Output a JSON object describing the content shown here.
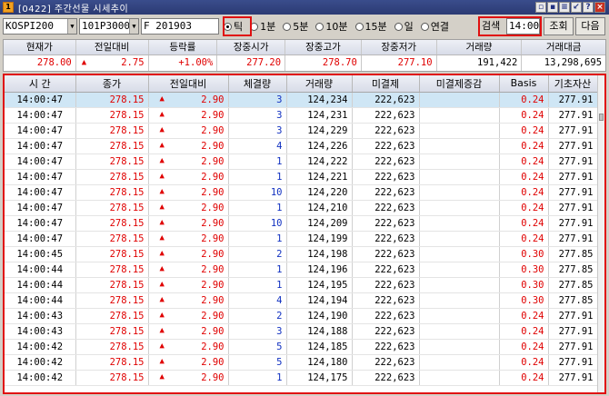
{
  "window": {
    "title": "[0422] 주간선물 시세추이",
    "app_icon": "1"
  },
  "toolbar": {
    "index_select": "KOSPI200",
    "product_select": "101P3000",
    "contract_value": "F 201903",
    "radios": [
      {
        "label": "틱",
        "checked": true
      },
      {
        "label": "1분",
        "checked": false
      },
      {
        "label": "5분",
        "checked": false
      },
      {
        "label": "10분",
        "checked": false
      },
      {
        "label": "15분",
        "checked": false
      },
      {
        "label": "일",
        "checked": false
      },
      {
        "label": "연결",
        "checked": false
      }
    ],
    "search_label": "검색",
    "search_time": "14:00",
    "query_button": "조회",
    "next_button": "다음"
  },
  "summary": {
    "headers": [
      "현재가",
      "전일대비",
      "등락률",
      "장중시가",
      "장중고가",
      "장중저가",
      "거래량",
      "거래대금"
    ],
    "values": {
      "current": "278.00",
      "change": "2.75",
      "rate": "+1.00%",
      "open": "277.20",
      "high": "278.70",
      "low": "277.10",
      "volume": "191,422",
      "amount": "13,298,695"
    }
  },
  "table": {
    "headers": [
      "시  간",
      "종가",
      "전일대비",
      "체결량",
      "거래량",
      "미결제",
      "미결제증감",
      "Basis",
      "기초자산"
    ],
    "rows": [
      {
        "time": "14:00:47",
        "close": "278.15",
        "change": "2.90",
        "qty": "3",
        "volume": "124,234",
        "oi": "222,623",
        "oi_chg": "",
        "basis": "0.24",
        "underlying": "277.91"
      },
      {
        "time": "14:00:47",
        "close": "278.15",
        "change": "2.90",
        "qty": "3",
        "volume": "124,231",
        "oi": "222,623",
        "oi_chg": "",
        "basis": "0.24",
        "underlying": "277.91"
      },
      {
        "time": "14:00:47",
        "close": "278.15",
        "change": "2.90",
        "qty": "3",
        "volume": "124,229",
        "oi": "222,623",
        "oi_chg": "",
        "basis": "0.24",
        "underlying": "277.91"
      },
      {
        "time": "14:00:47",
        "close": "278.15",
        "change": "2.90",
        "qty": "4",
        "volume": "124,226",
        "oi": "222,623",
        "oi_chg": "",
        "basis": "0.24",
        "underlying": "277.91"
      },
      {
        "time": "14:00:47",
        "close": "278.15",
        "change": "2.90",
        "qty": "1",
        "volume": "124,222",
        "oi": "222,623",
        "oi_chg": "",
        "basis": "0.24",
        "underlying": "277.91"
      },
      {
        "time": "14:00:47",
        "close": "278.15",
        "change": "2.90",
        "qty": "1",
        "volume": "124,221",
        "oi": "222,623",
        "oi_chg": "",
        "basis": "0.24",
        "underlying": "277.91"
      },
      {
        "time": "14:00:47",
        "close": "278.15",
        "change": "2.90",
        "qty": "10",
        "volume": "124,220",
        "oi": "222,623",
        "oi_chg": "",
        "basis": "0.24",
        "underlying": "277.91"
      },
      {
        "time": "14:00:47",
        "close": "278.15",
        "change": "2.90",
        "qty": "1",
        "volume": "124,210",
        "oi": "222,623",
        "oi_chg": "",
        "basis": "0.24",
        "underlying": "277.91"
      },
      {
        "time": "14:00:47",
        "close": "278.15",
        "change": "2.90",
        "qty": "10",
        "volume": "124,209",
        "oi": "222,623",
        "oi_chg": "",
        "basis": "0.24",
        "underlying": "277.91"
      },
      {
        "time": "14:00:47",
        "close": "278.15",
        "change": "2.90",
        "qty": "1",
        "volume": "124,199",
        "oi": "222,623",
        "oi_chg": "",
        "basis": "0.24",
        "underlying": "277.91"
      },
      {
        "time": "14:00:45",
        "close": "278.15",
        "change": "2.90",
        "qty": "2",
        "volume": "124,198",
        "oi": "222,623",
        "oi_chg": "",
        "basis": "0.30",
        "underlying": "277.85"
      },
      {
        "time": "14:00:44",
        "close": "278.15",
        "change": "2.90",
        "qty": "1",
        "volume": "124,196",
        "oi": "222,623",
        "oi_chg": "",
        "basis": "0.30",
        "underlying": "277.85"
      },
      {
        "time": "14:00:44",
        "close": "278.15",
        "change": "2.90",
        "qty": "1",
        "volume": "124,195",
        "oi": "222,623",
        "oi_chg": "",
        "basis": "0.30",
        "underlying": "277.85"
      },
      {
        "time": "14:00:44",
        "close": "278.15",
        "change": "2.90",
        "qty": "4",
        "volume": "124,194",
        "oi": "222,623",
        "oi_chg": "",
        "basis": "0.30",
        "underlying": "277.85"
      },
      {
        "time": "14:00:43",
        "close": "278.15",
        "change": "2.90",
        "qty": "2",
        "volume": "124,190",
        "oi": "222,623",
        "oi_chg": "",
        "basis": "0.24",
        "underlying": "277.91"
      },
      {
        "time": "14:00:43",
        "close": "278.15",
        "change": "2.90",
        "qty": "3",
        "volume": "124,188",
        "oi": "222,623",
        "oi_chg": "",
        "basis": "0.24",
        "underlying": "277.91"
      },
      {
        "time": "14:00:42",
        "close": "278.15",
        "change": "2.90",
        "qty": "5",
        "volume": "124,185",
        "oi": "222,623",
        "oi_chg": "",
        "basis": "0.24",
        "underlying": "277.91"
      },
      {
        "time": "14:00:42",
        "close": "278.15",
        "change": "2.90",
        "qty": "5",
        "volume": "124,180",
        "oi": "222,623",
        "oi_chg": "",
        "basis": "0.24",
        "underlying": "277.91"
      },
      {
        "time": "14:00:42",
        "close": "278.15",
        "change": "2.90",
        "qty": "1",
        "volume": "124,175",
        "oi": "222,623",
        "oi_chg": "",
        "basis": "0.24",
        "underlying": "277.91"
      }
    ],
    "qty_blue_values": [
      "3",
      "1",
      "10",
      "2",
      "5"
    ]
  },
  "colors": {
    "up": "#e00000",
    "qty_blue": "#1030c0",
    "highlight_box": "#e01010",
    "selected_row": "#cfe6f5"
  },
  "icons": [
    "app-icon",
    "window-layout-icon",
    "print-icon",
    "pin-icon",
    "help-icon",
    "close-icon",
    "up-triangle-icon",
    "dropdown-arrow-icon"
  ]
}
